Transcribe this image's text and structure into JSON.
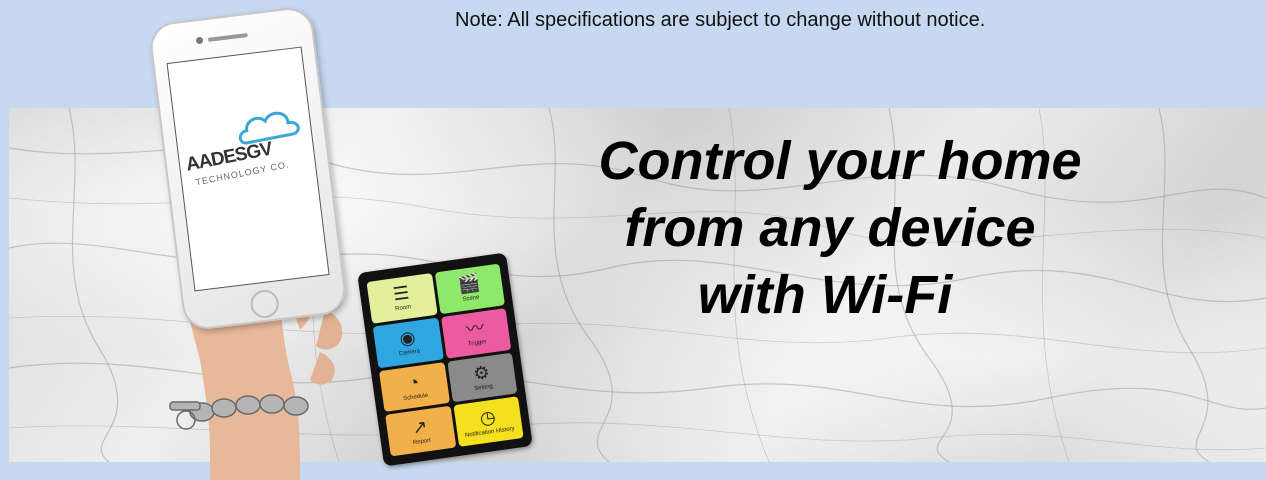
{
  "note": "Note: All specifications are subject to change without notice.",
  "headline": {
    "line1": "Control your home",
    "line2": "from any device",
    "line3": "with Wi-Fi"
  },
  "logo": {
    "brand": "AADESGV",
    "tagline": "TECHNOLOGY CO."
  },
  "tablet_tiles": [
    {
      "label": "Room",
      "icon": "list-icon",
      "color": "#e3ef9a"
    },
    {
      "label": "Scene",
      "icon": "clapperboard-icon",
      "color": "#8ee86a"
    },
    {
      "label": "Camera",
      "icon": "camera-icon",
      "color": "#2fa6e0"
    },
    {
      "label": "Trigger",
      "icon": "pulse-icon",
      "color": "#ec5aa0"
    },
    {
      "label": "Schedule",
      "icon": "clock-icon",
      "color": "#f2b04a"
    },
    {
      "label": "Setting",
      "icon": "gear-icon",
      "color": "#8a8a8a"
    },
    {
      "label": "Report",
      "icon": "chart-icon",
      "color": "#f2b04a"
    },
    {
      "label": "Notification History",
      "icon": "history-icon",
      "color": "#f5e020"
    }
  ],
  "colors": {
    "banner_bg": "#c6d9f1",
    "text": "#000000"
  }
}
